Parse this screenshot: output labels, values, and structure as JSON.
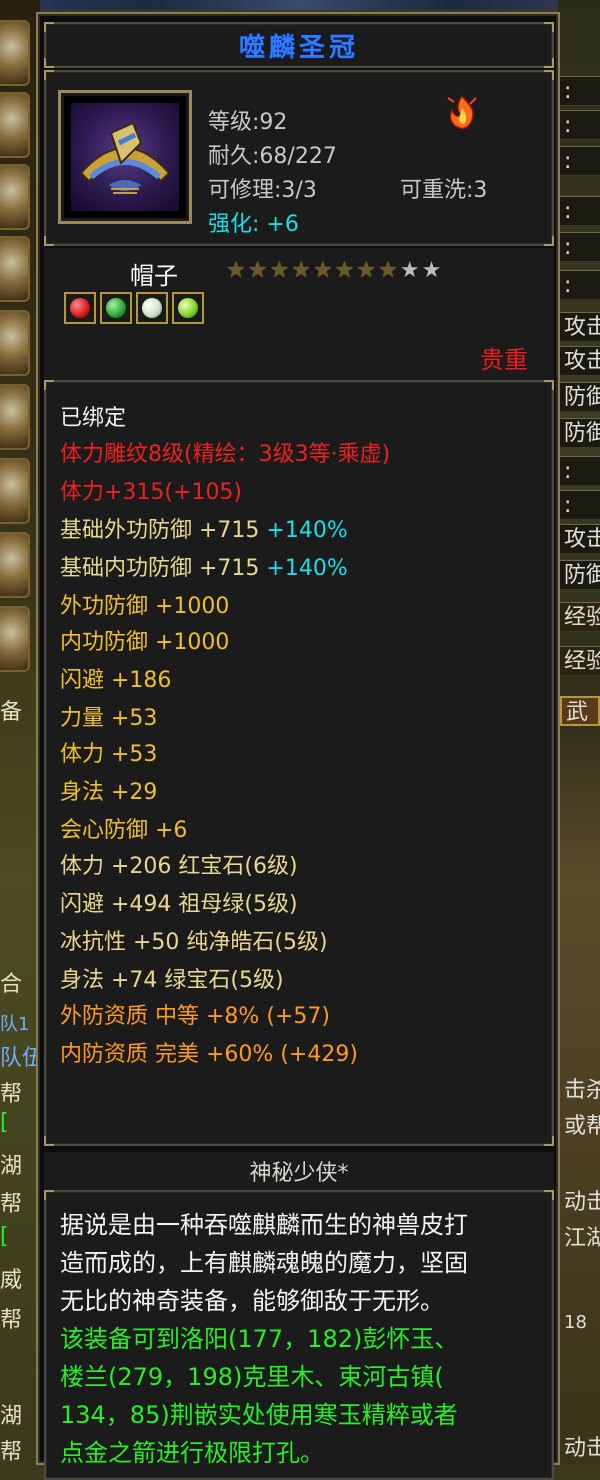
{
  "item": {
    "name": "噬麟圣冠",
    "level_line": "等级:92",
    "durability_line": "耐久:68/227",
    "repair_line": "可修理:3/3",
    "rewash_line": "可重洗:3",
    "enhance_line": "强化: +6",
    "type": "帽子",
    "stars_filled": 8,
    "stars_total": 10,
    "rarity": "贵重",
    "gems": [
      {
        "name": "ruby-gem",
        "color": "#d41818"
      },
      {
        "name": "emerald-gem",
        "color": "#28a030"
      },
      {
        "name": "white-jade-gem",
        "color": "#c8e0c8"
      },
      {
        "name": "green-gem",
        "color": "#7ad02a"
      }
    ]
  },
  "attributes": [
    {
      "text": "已绑定",
      "color": "white"
    },
    {
      "text": "体力雕纹8级(精绘：3级3等·乘虚)",
      "color": "red"
    },
    {
      "text": "体力+315(+105)",
      "color": "red"
    },
    {
      "text": "基础外功防御 +715",
      "extra": "+140%",
      "color": "yellow"
    },
    {
      "text": "基础内功防御 +715",
      "extra": "+140%",
      "color": "yellow"
    },
    {
      "text": "外功防御 +1000",
      "color": "gold"
    },
    {
      "text": "内功防御 +1000",
      "color": "gold"
    },
    {
      "text": "闪避 +186",
      "color": "gold"
    },
    {
      "text": "力量 +53",
      "color": "gold"
    },
    {
      "text": "体力 +53",
      "color": "gold"
    },
    {
      "text": "身法 +29",
      "color": "gold"
    },
    {
      "text": "会心防御 +6",
      "color": "gold"
    },
    {
      "text": "体力 +206 红宝石(6级)",
      "color": "yellow"
    },
    {
      "text": "闪避 +494 祖母绿(5级)",
      "color": "yellow"
    },
    {
      "text": "冰抗性 +50 纯净皓石(5级)",
      "color": "yellow"
    },
    {
      "text": "身法 +74 绿宝石(5级)",
      "color": "yellow"
    },
    {
      "text": "外防资质  中等 +8% (+57)",
      "color": "orange"
    },
    {
      "text": "内防资质  完美 +60% (+429)",
      "color": "orange"
    }
  ],
  "description": {
    "title": "神秘少侠*",
    "lines": [
      {
        "text": "据说是由一种吞噬麒麟而生的神兽皮打",
        "color": "white"
      },
      {
        "text": "造而成的，上有麒麟魂魄的魔力，坚固",
        "color": "white"
      },
      {
        "text": "无比的神奇装备，能够御敌于无形。",
        "color": "white"
      },
      {
        "text": "该装备可到洛阳(177，182)彭怀玉、",
        "color": "green"
      },
      {
        "text": "楼兰(279，198)克里木、束河古镇(",
        "color": "green"
      },
      {
        "text": "134，85)荆嵌实处使用寒玉精粹或者",
        "color": "green"
      },
      {
        "text": "点金之箭进行极限打孔。",
        "color": "green"
      }
    ]
  },
  "background": {
    "left_texts": [
      "备",
      "合",
      "队1",
      "队伍",
      "帮",
      "[",
      "湖",
      "帮",
      "[",
      "威",
      "帮",
      "湖",
      "帮"
    ],
    "right_texts": [
      ":",
      ":",
      ":",
      ":",
      ":",
      ":",
      "攻击",
      "攻击",
      "防御",
      "防御",
      ":",
      ":",
      "攻击",
      "防御",
      "经验",
      "经验",
      "武",
      "击杀",
      "或帮",
      "动击",
      "江湖",
      "18",
      "动击"
    ]
  }
}
